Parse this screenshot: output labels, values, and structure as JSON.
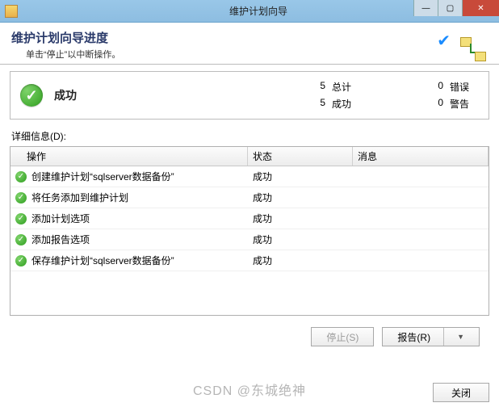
{
  "window": {
    "title": "维护计划向导"
  },
  "header": {
    "title": "维护计划向导进度",
    "subtitle": "单击“停止”以中断操作。"
  },
  "summary": {
    "status_label": "成功",
    "total_count": "5",
    "total_label": "总计",
    "success_count": "5",
    "success_label": "成功",
    "error_count": "0",
    "error_label": "错误",
    "warning_count": "0",
    "warning_label": "警告"
  },
  "details": {
    "label": "详细信息(D):",
    "columns": {
      "action": "操作",
      "status": "状态",
      "message": "消息"
    },
    "rows": [
      {
        "action": "创建维护计划“sqlserver数据备份”",
        "status": "成功",
        "message": ""
      },
      {
        "action": "将任务添加到维护计划",
        "status": "成功",
        "message": ""
      },
      {
        "action": "添加计划选项",
        "status": "成功",
        "message": ""
      },
      {
        "action": "添加报告选项",
        "status": "成功",
        "message": ""
      },
      {
        "action": "保存维护计划“sqlserver数据备份”",
        "status": "成功",
        "message": ""
      }
    ]
  },
  "buttons": {
    "stop": "停止(S)",
    "report": "报告(R)",
    "close": "关闭"
  },
  "watermark": "CSDN @东城绝神"
}
